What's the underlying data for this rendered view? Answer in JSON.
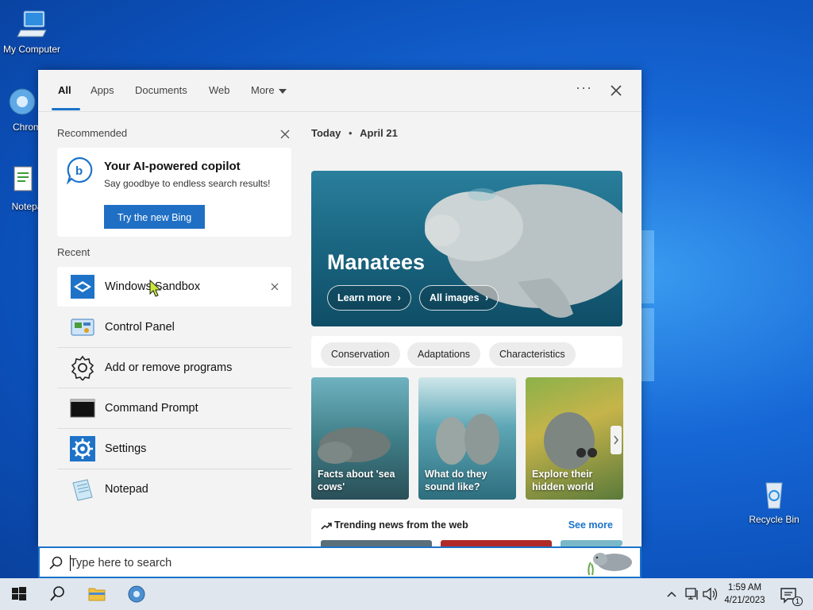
{
  "desktop": {
    "icons": [
      {
        "label": "My Computer"
      },
      {
        "label": "Chrom"
      },
      {
        "label": "Notepa"
      },
      {
        "label": "Recycle Bin"
      }
    ]
  },
  "tabs": [
    {
      "label": "All",
      "active": true
    },
    {
      "label": "Apps"
    },
    {
      "label": "Documents"
    },
    {
      "label": "Web"
    },
    {
      "label": "More"
    }
  ],
  "header": {
    "more_options": "···"
  },
  "recommended": {
    "title": "Recommended",
    "card_title": "Your AI-powered copilot",
    "card_subtitle": "Say goodbye to endless search results!",
    "button_label": "Try the new Bing"
  },
  "recent": {
    "title": "Recent",
    "items": [
      {
        "label": "Windows Sandbox",
        "icon": "windows-sandbox-icon"
      },
      {
        "label": "Control Panel",
        "icon": "control-panel-icon"
      },
      {
        "label": "Add or remove programs",
        "icon": "gear-outline-icon"
      },
      {
        "label": "Command Prompt",
        "icon": "command-prompt-icon"
      },
      {
        "label": "Settings",
        "icon": "settings-gear-icon"
      },
      {
        "label": "Notepad",
        "icon": "notepad-icon"
      }
    ]
  },
  "today": {
    "label": "Today",
    "date": "April 21"
  },
  "hero": {
    "title": "Manatees",
    "learn_more": "Learn more",
    "all_images": "All images"
  },
  "chips": [
    "Conservation",
    "Adaptations",
    "Characteristics"
  ],
  "cards": [
    {
      "caption": "Facts about 'sea cows'"
    },
    {
      "caption": "What do they sound like?"
    },
    {
      "caption": "Explore their hidden world"
    }
  ],
  "trending": {
    "title": "Trending news from the web",
    "see_more": "See more"
  },
  "search": {
    "placeholder": "Type here to search"
  },
  "clock": {
    "time": "1:59 AM",
    "date": "4/21/2023"
  },
  "notifications": {
    "count": "1"
  },
  "colors": {
    "accent": "#1a73c9",
    "bing_button": "#1f6fc5",
    "taskbar": "#dfe6ee"
  }
}
